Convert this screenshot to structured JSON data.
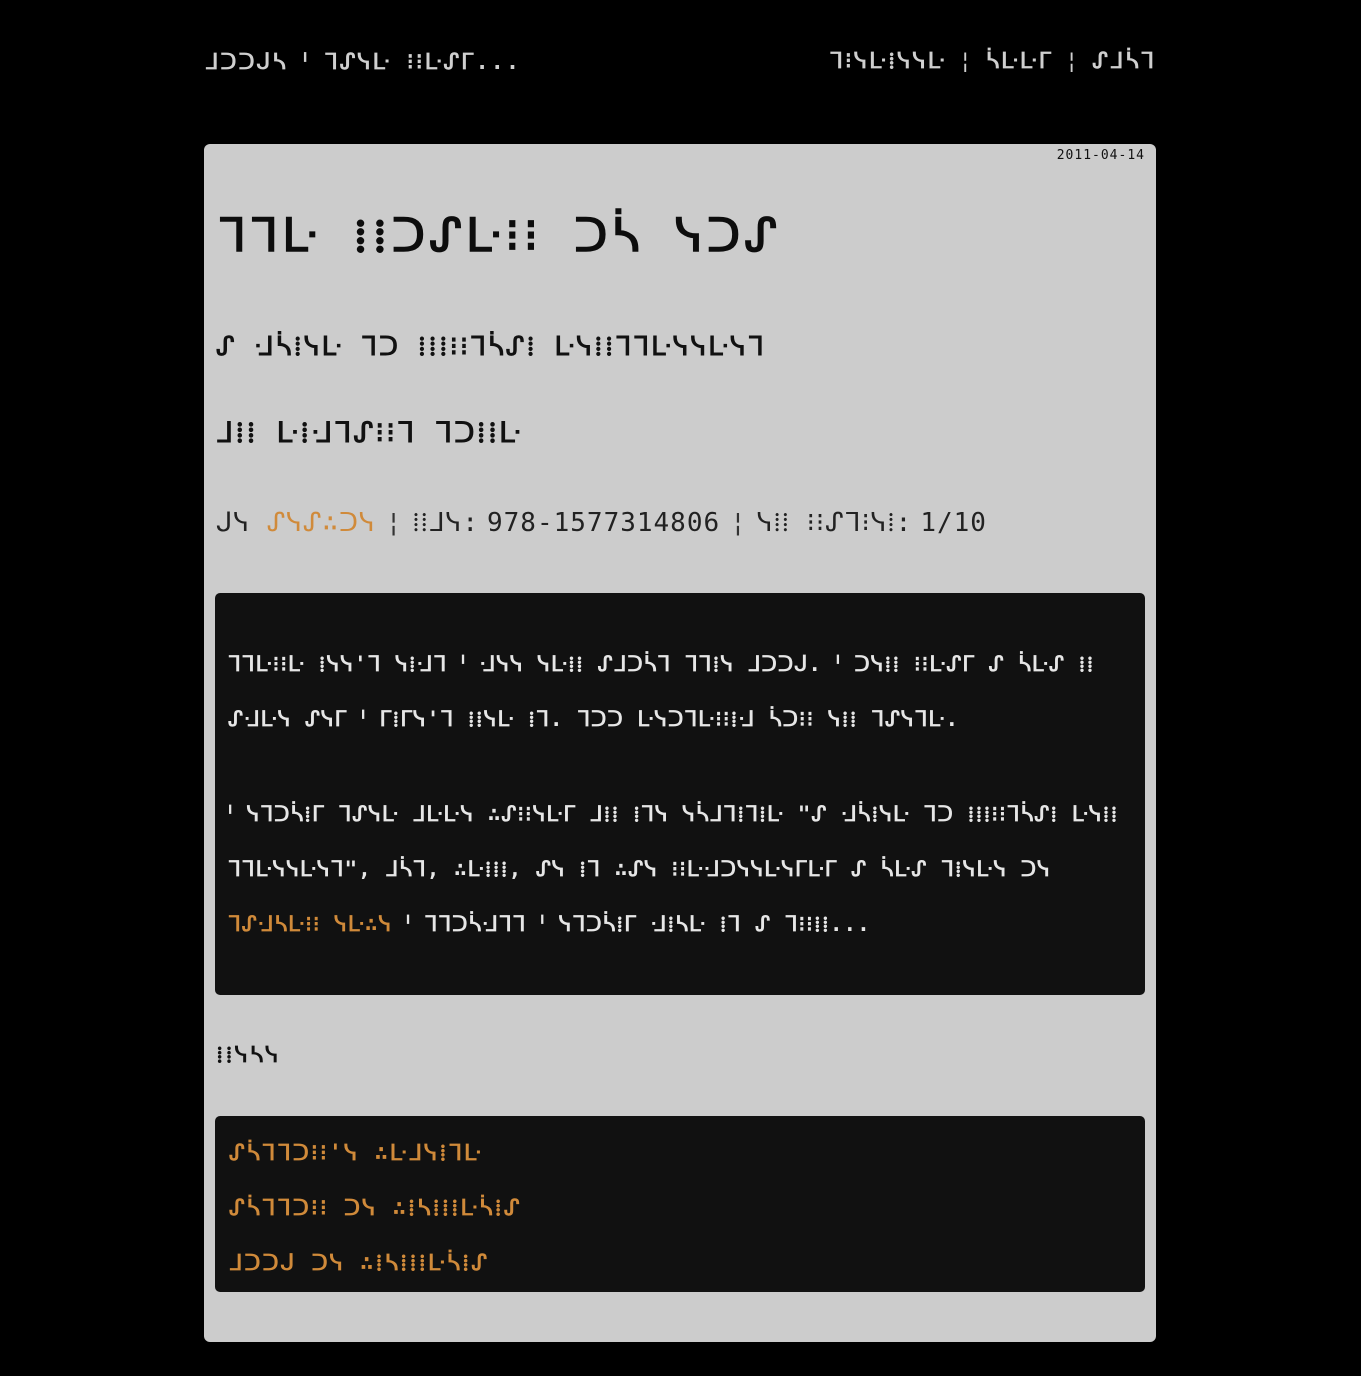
{
  "site": {
    "title": "ᒧᑐᑐᒍᓴ ᑊ ᒣᔑᓭᒷ ⁝⁝ᒷᔑᒥ..."
  },
  "nav": {
    "items": [
      {
        "label": "ᒣ⁝ᓭᒷ⁞ᓭᓭᒷ"
      },
      {
        "label": "ᓵᒷᒷᒥ"
      },
      {
        "label": "ᔑᒧᓵᒣ"
      }
    ],
    "separator": "¦"
  },
  "review": {
    "date": "2011-04-14",
    "title": "ᒣᒣᒷ ⁞⁞ᑐᔑᒷ⁝⁝ ᑐᓵ ᓭᑐᔑ",
    "subtitle": "ᔑ ᒲᓵ⁞ᓭᒷ ᒣᑐ ⁞⁞⁞⁝⁝ᒣᓵᔑ⁞ ᒷᓭ⁞⁞ᒣᒣᒷᓭᓭᒷᓭᒣ",
    "author_line": "ᒧ⁞⁞ ᒷ⁞ᒲᒣᔑ⁝⁝ᒣ ᒣᑐ⁞⁞ᒷ",
    "meta": {
      "by_label": "ᒍᓭ",
      "reviewer": "ᔑᓭᔑ∴ᑐᓭ",
      "isbn_label": "⁞⁞ᒧᓭ:",
      "isbn": "978-1577314806",
      "rating_label": "ᓭ⁞⁞ ⁝⁝ᔑᒣ⁝ᓭ⁞:",
      "rating": "1/10",
      "separator": "¦"
    },
    "body": {
      "p1": "ᒣᒣᒷ⁝⁝ᒷ ⁞ᓭᓭ'ᒣ ᓭ⁞ᒲᒣ ᑊ ᒲᓭᓭ ᓭᒷ⁞⁞ ᔑᒧᑐᓵᒣ ᒣᒣ⁞ᓭ ᒧᑐᑐᒍ. ᑊ ᑐᓭ⁞⁞ ⁝⁝ᒷᔑᒥ ᔑ ᓵᒷᔑ ⁞⁞ᔑᒲᒷᓭ ᔑᓭᒥ ᑊ ᒥ⁞ᒥᓭ'ᒣ ⁞⁞ᓭᒷ ⁞ᒣ. ᒣᑐᑐ ᒷᓭᑐᒣᒷ⁝⁝⁞ᒲ ᓵᑐ⁝⁝ ᓭ⁞⁞ ᒣᔑᓭᒣᒷ.",
      "p2_before": "ᑊ ᓭᒣᑐᓵ⁞ᒥ ᒣᔑᓭᒷ ᒧᒷᒷᓭ ∴ᔑ⁝⁝ᓭᒷᒥ ᒧ⁞⁞ ⁞ᒣᓭ ᓭᓵᒧᒣ⁞ᒣ⁞ᒷ \"ᔑ ᒲᓵ⁞ᓭᒷ ᒣᑐ ⁞⁞⁞⁝⁝ᒣᓵᔑ⁞ ᒷᓭ⁞⁞ᒣᒣᒷᓭᓭᒷᓭᒣ\", ᒧᓵᒣ, ∴ᒷ⁞⁞⁞, ᔑᓭ ⁞ᒣ ∴ᔑᓭ ⁝⁝ᒷᒲᑐᓭᓭᒷᓭᒥᒷᒥ ᔑ ᓵᒷᔑ ᒣ⁞ᓭᒷᓭ ᑐᓭ",
      "p2_link": "ᒣᔑᒲᓴᒷ⁝⁝ ᓭᒷ∴ᓭ",
      "p2_after": "ᑊ ᒣᒣᑐᓵᒲᒣᒣ ᑊ ᓭᒣᑐᓵ⁞ᒥ ᒲ⁞ᓴᒷ ⁞ᒣ ᔑ ᒣ⁝⁝⁞⁞..."
    }
  },
  "links": {
    "heading": "⁞⁞ᓭᓴᓭ",
    "items": [
      {
        "label": "ᔑᓵᒣᒣᑐ⁝⁝'ᓭ ∴ᒷᒧᓭ⁞ᒣᒷ"
      },
      {
        "label": "ᔑᓵᒣᒣᑐ⁝⁝ ᑐᓭ ∴⁞ᓴ⁞⁞⁞ᒷᓵ⁞ᔑ"
      },
      {
        "label": "ᒧᑐᑐᒍ ᑐᓭ ∴⁞ᓴ⁞⁞⁞ᒷᓵ⁞ᔑ"
      }
    ]
  },
  "colors": {
    "background": "#000000",
    "card": "#cccccc",
    "panel": "#111111",
    "accent": "#d08a3a"
  }
}
